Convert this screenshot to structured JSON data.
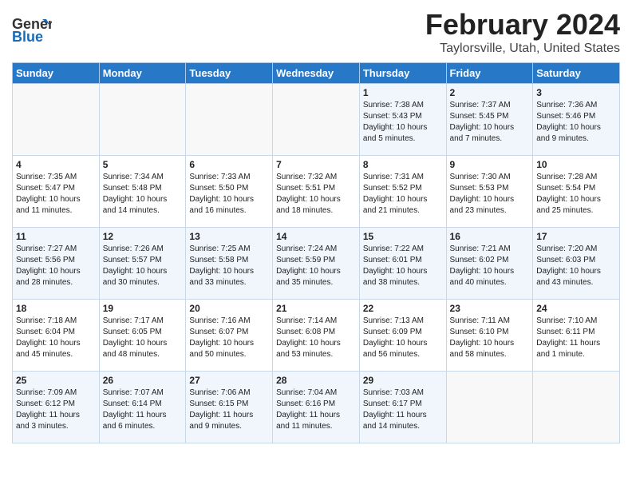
{
  "logo": {
    "line1": "General",
    "line2": "Blue"
  },
  "title": "February 2024",
  "subtitle": "Taylorsville, Utah, United States",
  "days_of_week": [
    "Sunday",
    "Monday",
    "Tuesday",
    "Wednesday",
    "Thursday",
    "Friday",
    "Saturday"
  ],
  "weeks": [
    [
      {
        "day": "",
        "content": ""
      },
      {
        "day": "",
        "content": ""
      },
      {
        "day": "",
        "content": ""
      },
      {
        "day": "",
        "content": ""
      },
      {
        "day": "1",
        "content": "Sunrise: 7:38 AM\nSunset: 5:43 PM\nDaylight: 10 hours\nand 5 minutes."
      },
      {
        "day": "2",
        "content": "Sunrise: 7:37 AM\nSunset: 5:45 PM\nDaylight: 10 hours\nand 7 minutes."
      },
      {
        "day": "3",
        "content": "Sunrise: 7:36 AM\nSunset: 5:46 PM\nDaylight: 10 hours\nand 9 minutes."
      }
    ],
    [
      {
        "day": "4",
        "content": "Sunrise: 7:35 AM\nSunset: 5:47 PM\nDaylight: 10 hours\nand 11 minutes."
      },
      {
        "day": "5",
        "content": "Sunrise: 7:34 AM\nSunset: 5:48 PM\nDaylight: 10 hours\nand 14 minutes."
      },
      {
        "day": "6",
        "content": "Sunrise: 7:33 AM\nSunset: 5:50 PM\nDaylight: 10 hours\nand 16 minutes."
      },
      {
        "day": "7",
        "content": "Sunrise: 7:32 AM\nSunset: 5:51 PM\nDaylight: 10 hours\nand 18 minutes."
      },
      {
        "day": "8",
        "content": "Sunrise: 7:31 AM\nSunset: 5:52 PM\nDaylight: 10 hours\nand 21 minutes."
      },
      {
        "day": "9",
        "content": "Sunrise: 7:30 AM\nSunset: 5:53 PM\nDaylight: 10 hours\nand 23 minutes."
      },
      {
        "day": "10",
        "content": "Sunrise: 7:28 AM\nSunset: 5:54 PM\nDaylight: 10 hours\nand 25 minutes."
      }
    ],
    [
      {
        "day": "11",
        "content": "Sunrise: 7:27 AM\nSunset: 5:56 PM\nDaylight: 10 hours\nand 28 minutes."
      },
      {
        "day": "12",
        "content": "Sunrise: 7:26 AM\nSunset: 5:57 PM\nDaylight: 10 hours\nand 30 minutes."
      },
      {
        "day": "13",
        "content": "Sunrise: 7:25 AM\nSunset: 5:58 PM\nDaylight: 10 hours\nand 33 minutes."
      },
      {
        "day": "14",
        "content": "Sunrise: 7:24 AM\nSunset: 5:59 PM\nDaylight: 10 hours\nand 35 minutes."
      },
      {
        "day": "15",
        "content": "Sunrise: 7:22 AM\nSunset: 6:01 PM\nDaylight: 10 hours\nand 38 minutes."
      },
      {
        "day": "16",
        "content": "Sunrise: 7:21 AM\nSunset: 6:02 PM\nDaylight: 10 hours\nand 40 minutes."
      },
      {
        "day": "17",
        "content": "Sunrise: 7:20 AM\nSunset: 6:03 PM\nDaylight: 10 hours\nand 43 minutes."
      }
    ],
    [
      {
        "day": "18",
        "content": "Sunrise: 7:18 AM\nSunset: 6:04 PM\nDaylight: 10 hours\nand 45 minutes."
      },
      {
        "day": "19",
        "content": "Sunrise: 7:17 AM\nSunset: 6:05 PM\nDaylight: 10 hours\nand 48 minutes."
      },
      {
        "day": "20",
        "content": "Sunrise: 7:16 AM\nSunset: 6:07 PM\nDaylight: 10 hours\nand 50 minutes."
      },
      {
        "day": "21",
        "content": "Sunrise: 7:14 AM\nSunset: 6:08 PM\nDaylight: 10 hours\nand 53 minutes."
      },
      {
        "day": "22",
        "content": "Sunrise: 7:13 AM\nSunset: 6:09 PM\nDaylight: 10 hours\nand 56 minutes."
      },
      {
        "day": "23",
        "content": "Sunrise: 7:11 AM\nSunset: 6:10 PM\nDaylight: 10 hours\nand 58 minutes."
      },
      {
        "day": "24",
        "content": "Sunrise: 7:10 AM\nSunset: 6:11 PM\nDaylight: 11 hours\nand 1 minute."
      }
    ],
    [
      {
        "day": "25",
        "content": "Sunrise: 7:09 AM\nSunset: 6:12 PM\nDaylight: 11 hours\nand 3 minutes."
      },
      {
        "day": "26",
        "content": "Sunrise: 7:07 AM\nSunset: 6:14 PM\nDaylight: 11 hours\nand 6 minutes."
      },
      {
        "day": "27",
        "content": "Sunrise: 7:06 AM\nSunset: 6:15 PM\nDaylight: 11 hours\nand 9 minutes."
      },
      {
        "day": "28",
        "content": "Sunrise: 7:04 AM\nSunset: 6:16 PM\nDaylight: 11 hours\nand 11 minutes."
      },
      {
        "day": "29",
        "content": "Sunrise: 7:03 AM\nSunset: 6:17 PM\nDaylight: 11 hours\nand 14 minutes."
      },
      {
        "day": "",
        "content": ""
      },
      {
        "day": "",
        "content": ""
      }
    ]
  ]
}
